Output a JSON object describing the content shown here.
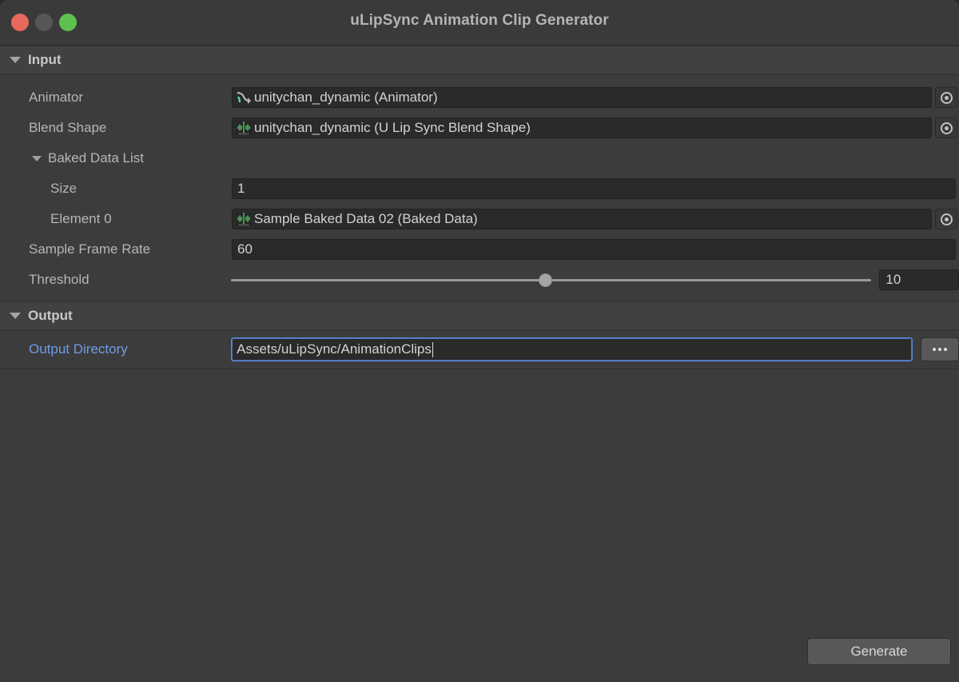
{
  "window": {
    "title": "uLipSync Animation Clip Generator",
    "traffic_lights": {
      "close": "close-button",
      "minimize": "minimize-button",
      "maximize": "maximize-button"
    },
    "colors": {
      "body_bg": "#3c3c3c",
      "header_bg": "#414141",
      "field_bg": "#2a2a2a",
      "accent_blue": "#6f9ce8",
      "focus_border": "#5a8ad8",
      "traffic_red": "#e8685c",
      "traffic_gray": "#575757",
      "traffic_green": "#5ec14e",
      "script_icon_green": "#5ad06a"
    }
  },
  "input_section": {
    "label": "Input",
    "animator": {
      "label": "Animator",
      "value": "unitychan_dynamic (Animator)",
      "icon": "animator-icon",
      "picker": "object-picker-icon"
    },
    "blend_shape": {
      "label": "Blend Shape",
      "value": "unitychan_dynamic (U Lip Sync Blend Shape)",
      "icon": "script-audio-icon",
      "picker": "object-picker-icon"
    },
    "baked_data_list": {
      "label": "Baked Data List",
      "size": {
        "label": "Size",
        "value": "1"
      },
      "elements": [
        {
          "label": "Element 0",
          "value": "Sample Baked Data 02 (Baked Data)",
          "icon": "script-audio-icon",
          "picker": "object-picker-icon"
        }
      ]
    },
    "sample_frame_rate": {
      "label": "Sample Frame Rate",
      "value": "60"
    },
    "threshold": {
      "label": "Threshold",
      "value": "10",
      "slider_percent": 49
    }
  },
  "output_section": {
    "label": "Output",
    "output_directory": {
      "label": "Output Directory",
      "value": "Assets/uLipSync/AnimationClips",
      "browse_button": "..."
    }
  },
  "footer": {
    "generate_label": "Generate"
  }
}
